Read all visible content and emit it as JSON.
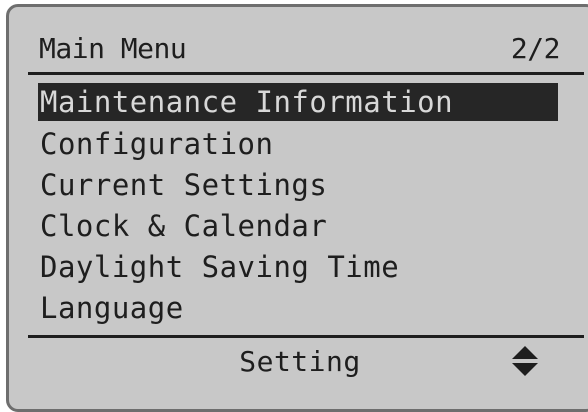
{
  "screen": {
    "title": "Main Menu",
    "page_indicator": "2/2"
  },
  "menu": {
    "items": [
      {
        "label": "Maintenance Information",
        "selected": true
      },
      {
        "label": "Configuration",
        "selected": false
      },
      {
        "label": "Current Settings",
        "selected": false
      },
      {
        "label": "Clock & Calendar",
        "selected": false
      },
      {
        "label": "Daylight Saving Time",
        "selected": false
      },
      {
        "label": "Language",
        "selected": false
      }
    ]
  },
  "footer": {
    "label": "Setting",
    "icon": "up-down-arrows-icon"
  },
  "colors": {
    "lcd_background": "#c8c8c8",
    "text": "#1e1e1e",
    "highlight_background": "#262626",
    "highlight_text": "#d8d8d8"
  }
}
